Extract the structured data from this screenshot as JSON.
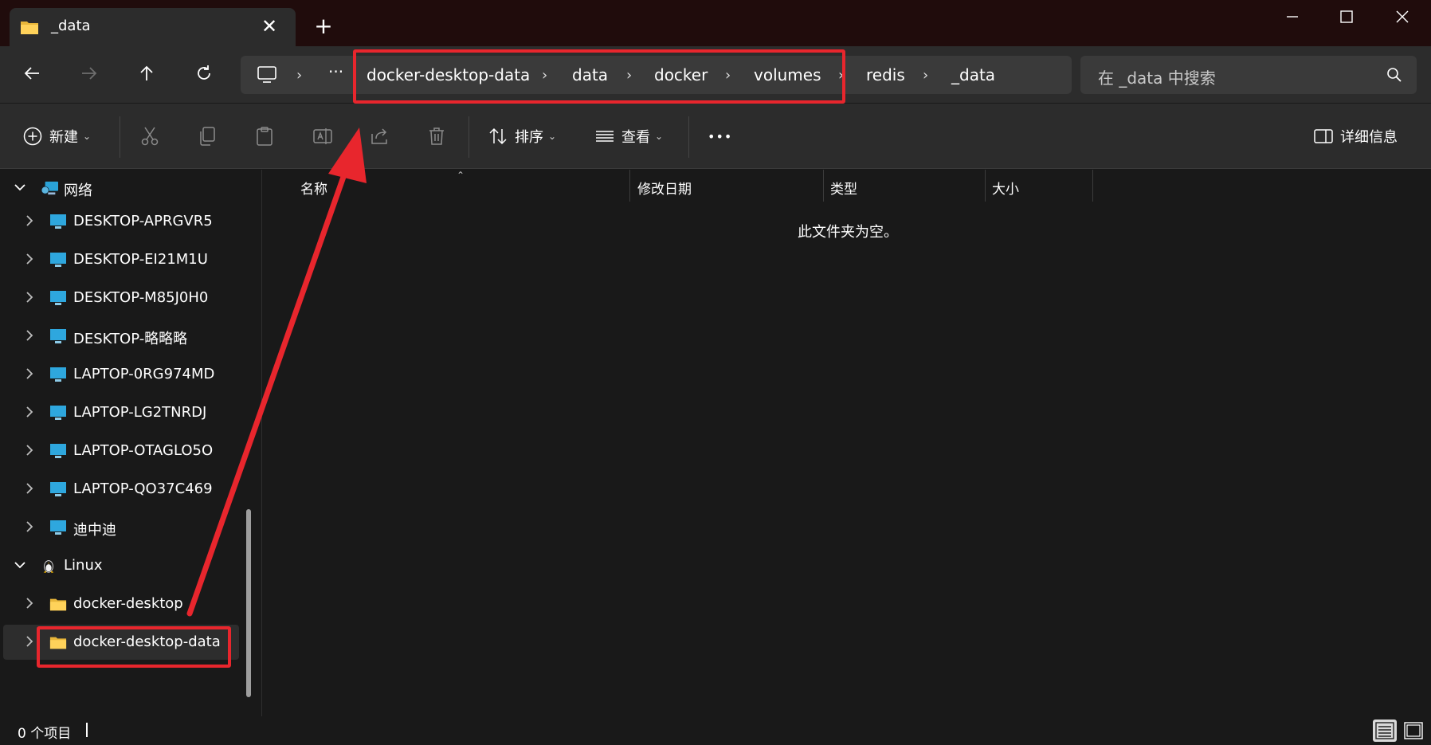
{
  "tab": {
    "title": "_data",
    "folder_icon": "folder-icon",
    "close_glyph": "✕",
    "new_tab_glyph": "+"
  },
  "nav": {
    "address": {
      "overflow": "···",
      "segments": [
        "docker-desktop-data",
        "data",
        "docker",
        "volumes",
        "redis",
        "_data"
      ],
      "separator": "›"
    },
    "search_placeholder": "在 _data 中搜索"
  },
  "toolbar": {
    "new_label": "新建",
    "sort_label": "排序",
    "view_label": "查看",
    "more_label": "•••",
    "details_label": "详细信息"
  },
  "navpane": {
    "network_label": "网络",
    "computers": [
      "DESKTOP-APRGVR5",
      "DESKTOP-EI21M1U",
      "DESKTOP-M85J0H0",
      "DESKTOP-略略略",
      "LAPTOP-0RG974MD",
      "LAPTOP-LG2TNRDJ",
      "LAPTOP-OTAGLO5O",
      "LAPTOP-QO37C469",
      "迪中迪"
    ],
    "linux_label": "Linux",
    "linux_items": [
      "docker-desktop",
      "docker-desktop-data"
    ]
  },
  "content": {
    "columns": [
      "名称",
      "修改日期",
      "类型",
      "大小"
    ],
    "empty_message": "此文件夹为空。"
  },
  "status": {
    "item_count": "0 个项目"
  },
  "colors": {
    "annotation_red": "#e8262d",
    "background": "#191919",
    "chrome": "#2c2c2c"
  }
}
